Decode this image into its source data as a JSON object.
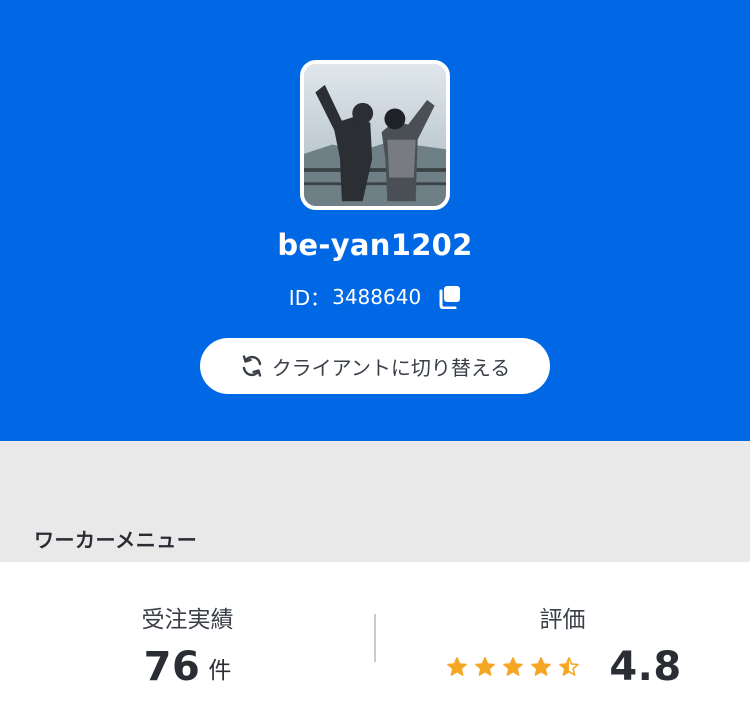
{
  "profile": {
    "username": "be-yan1202",
    "id_prefix": "ID：",
    "id_value": "3488640",
    "avatar_icon": "profile-photo",
    "copy_icon": "copy-icon"
  },
  "switch_button": {
    "label": "クライアントに切り替える",
    "icon": "refresh-icon"
  },
  "section": {
    "title": "ワーカーメニュー"
  },
  "stats": {
    "orders": {
      "label": "受注実績",
      "value": "76",
      "unit": "件"
    },
    "rating": {
      "label": "評価",
      "value": "4.8",
      "stars_filled": 4.5,
      "stars_total": 5
    }
  },
  "colors": {
    "header_bg": "#0068e5",
    "band_bg": "#e9e9ea",
    "star": "#f5a623",
    "text_dark": "#2a2d33"
  }
}
